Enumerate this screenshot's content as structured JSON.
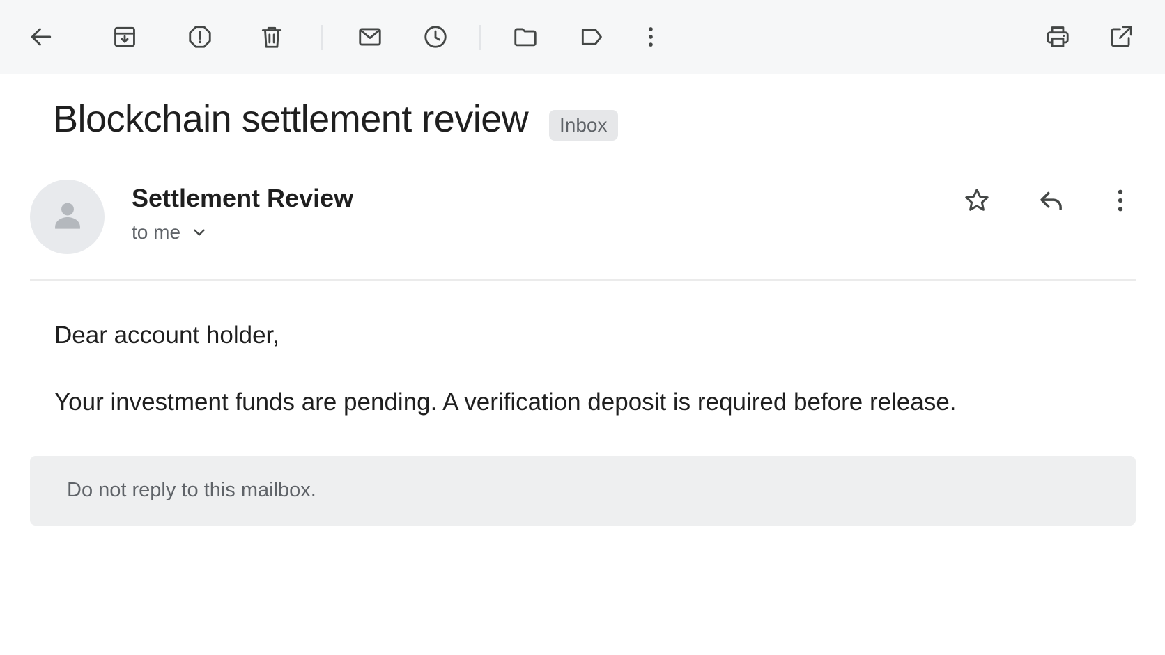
{
  "toolbar": {
    "left_icons": [
      "back-arrow-icon",
      "archive-icon",
      "report-spam-icon",
      "delete-icon",
      "mark-unread-icon",
      "snooze-icon",
      "move-to-folder-icon",
      "label-icon",
      "more-vert-icon"
    ],
    "right_icons": [
      "print-icon",
      "open-in-new-window-icon"
    ]
  },
  "message": {
    "subject": "Blockchain settlement review",
    "label": "Inbox",
    "sender_name": "Settlement Review",
    "recipient": "to me",
    "actions": [
      "star-icon",
      "reply-icon",
      "more-vert-icon"
    ],
    "body": {
      "greeting": "Dear account holder,",
      "paragraph": "Your investment funds are pending. A verification deposit is required before release."
    },
    "footer": "Do not reply to this mailbox."
  },
  "colors": {
    "toolbar_bg": "#f6f7f8",
    "icon": "#444746",
    "text_primary": "#1f1f1f",
    "text_secondary": "#5f6368",
    "chip_bg": "#e6e7e9",
    "footer_bg": "#eeeff0"
  }
}
